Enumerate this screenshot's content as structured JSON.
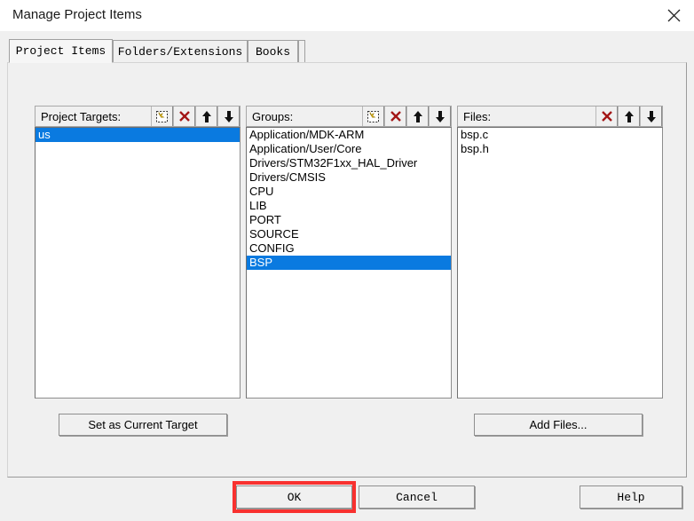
{
  "window": {
    "title": "Manage Project Items",
    "close_icon": "close-icon"
  },
  "tabs": [
    {
      "label": "Project Items",
      "active": true
    },
    {
      "label": "Folders/Extensions",
      "active": false
    },
    {
      "label": "Books",
      "active": false
    }
  ],
  "panels": {
    "targets": {
      "header_label": "Project Targets:",
      "tools": [
        "new-item-icon",
        "delete-icon",
        "move-up-icon",
        "move-down-icon"
      ],
      "items": [
        {
          "label": "us",
          "selected": true
        }
      ]
    },
    "groups": {
      "header_label": "Groups:",
      "tools": [
        "new-item-icon",
        "delete-icon",
        "move-up-icon",
        "move-down-icon"
      ],
      "items": [
        {
          "label": "Application/MDK-ARM",
          "selected": false
        },
        {
          "label": "Application/User/Core",
          "selected": false
        },
        {
          "label": "Drivers/STM32F1xx_HAL_Driver",
          "selected": false
        },
        {
          "label": "Drivers/CMSIS",
          "selected": false
        },
        {
          "label": "CPU",
          "selected": false
        },
        {
          "label": "LIB",
          "selected": false
        },
        {
          "label": "PORT",
          "selected": false
        },
        {
          "label": "SOURCE",
          "selected": false
        },
        {
          "label": "CONFIG",
          "selected": false
        },
        {
          "label": "BSP",
          "selected": true
        }
      ]
    },
    "files": {
      "header_label": "Files:",
      "tools": [
        "delete-icon",
        "move-up-icon",
        "move-down-icon"
      ],
      "items": [
        {
          "label": "bsp.c",
          "selected": false
        },
        {
          "label": "bsp.h",
          "selected": false
        }
      ]
    }
  },
  "actions": {
    "set_current_target": "Set as Current Target",
    "add_files": "Add Files...",
    "ok": "OK",
    "cancel": "Cancel",
    "help": "Help"
  },
  "colors": {
    "selection_blue": "#0a7ae0",
    "annotation_red": "#f8312f",
    "dialog_bg": "#f0f0f0",
    "delete_icon_red": "#a31616"
  }
}
